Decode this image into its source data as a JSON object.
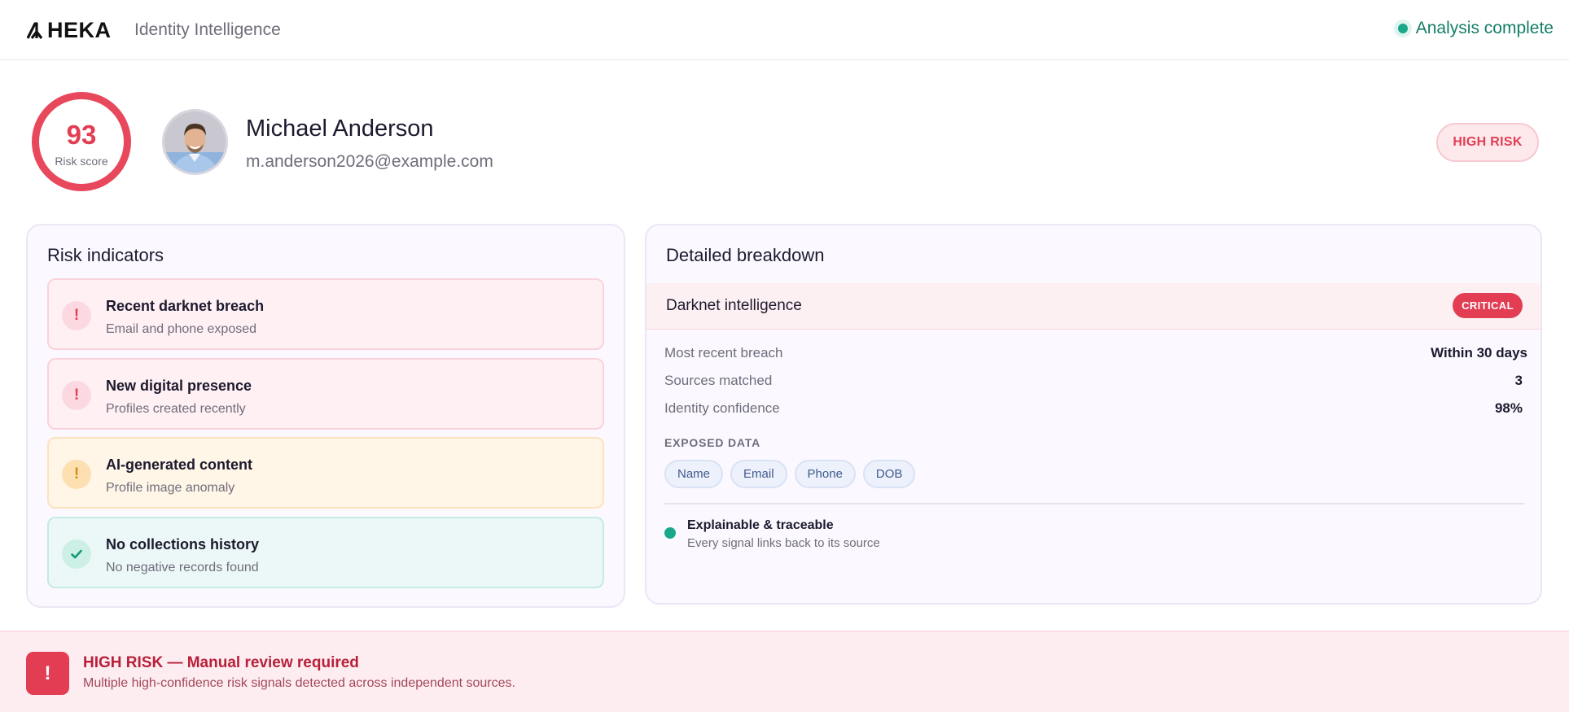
{
  "header": {
    "brand": "HEKA",
    "subtitle": "Identity Intelligence",
    "status": "Analysis complete",
    "status_color": "#1aa88a"
  },
  "profile": {
    "score": "93",
    "score_label": "Risk score",
    "name": "Michael Anderson",
    "email": "m.anderson2026@example.com",
    "risk_badge": "HIGH RISK",
    "accent_color": "#e23d52"
  },
  "risk_indicators": {
    "title": "Risk indicators",
    "items": [
      {
        "icon": "exclamation-icon",
        "severity": "red",
        "title": "Recent darknet breach",
        "subtitle": "Email and phone exposed"
      },
      {
        "icon": "exclamation-icon",
        "severity": "red",
        "title": "New digital presence",
        "subtitle": "Profiles created recently"
      },
      {
        "icon": "exclamation-icon",
        "severity": "amber",
        "title": "AI-generated content",
        "subtitle": "Profile image anomaly"
      },
      {
        "icon": "check-icon",
        "severity": "green",
        "title": "No collections history",
        "subtitle": "No negative records found"
      }
    ]
  },
  "breakdown": {
    "title": "Detailed breakdown",
    "section": "Darknet intelligence",
    "section_badge": "CRITICAL",
    "rows": [
      {
        "label": "Most recent breach",
        "value": "Within 30 days"
      },
      {
        "label": "Sources matched",
        "value": "3"
      },
      {
        "label": "Identity confidence",
        "value": "98%"
      }
    ],
    "exposed_label": "EXPOSED DATA",
    "exposed_tags": [
      "Name",
      "Email",
      "Phone",
      "DOB"
    ],
    "trace_title": "Explainable & traceable",
    "trace_subtitle": "Every signal links back to its source"
  },
  "alert": {
    "icon": "exclamation-icon",
    "title": "HIGH RISK — Manual review required",
    "subtitle": "Multiple high-confidence risk signals detected across independent sources."
  }
}
